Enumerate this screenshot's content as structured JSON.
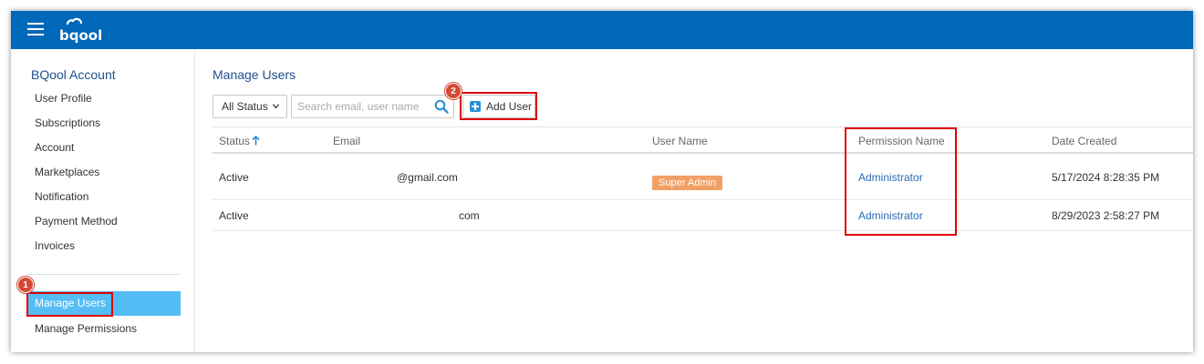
{
  "sidebar": {
    "title": "BQool Account",
    "items": [
      {
        "label": "User Profile"
      },
      {
        "label": "Subscriptions"
      },
      {
        "label": "Account"
      },
      {
        "label": "Marketplaces"
      },
      {
        "label": "Notification"
      },
      {
        "label": "Payment Method"
      },
      {
        "label": "Invoices"
      }
    ],
    "active_item": "Manage Users",
    "permissions_item": "Manage Permissions"
  },
  "main": {
    "title": "Manage Users",
    "status_filter": {
      "selected": "All Status"
    },
    "search": {
      "placeholder": "Search email, user name",
      "value": ""
    },
    "add_user_label": "Add User",
    "table": {
      "columns": {
        "status": "Status",
        "email": "Email",
        "user_name": "User Name",
        "permission_name": "Permission Name",
        "date_created": "Date Created"
      },
      "rows": [
        {
          "status": "Active",
          "email": "@gmail.com",
          "badge": "Super Admin",
          "permission": "Administrator",
          "date_created": "5/17/2024 8:28:35 PM"
        },
        {
          "status": "Active",
          "email": "com",
          "permission": "Administrator",
          "date_created": "8/29/2023 2:58:27 PM"
        }
      ]
    }
  },
  "annotations": {
    "step1": "1",
    "step2": "2"
  },
  "colors": {
    "topbar": "#0068b8",
    "active_item": "#55bdf5",
    "badge": "#f0a064",
    "callout": "#e00000",
    "link": "#2a6db0"
  }
}
